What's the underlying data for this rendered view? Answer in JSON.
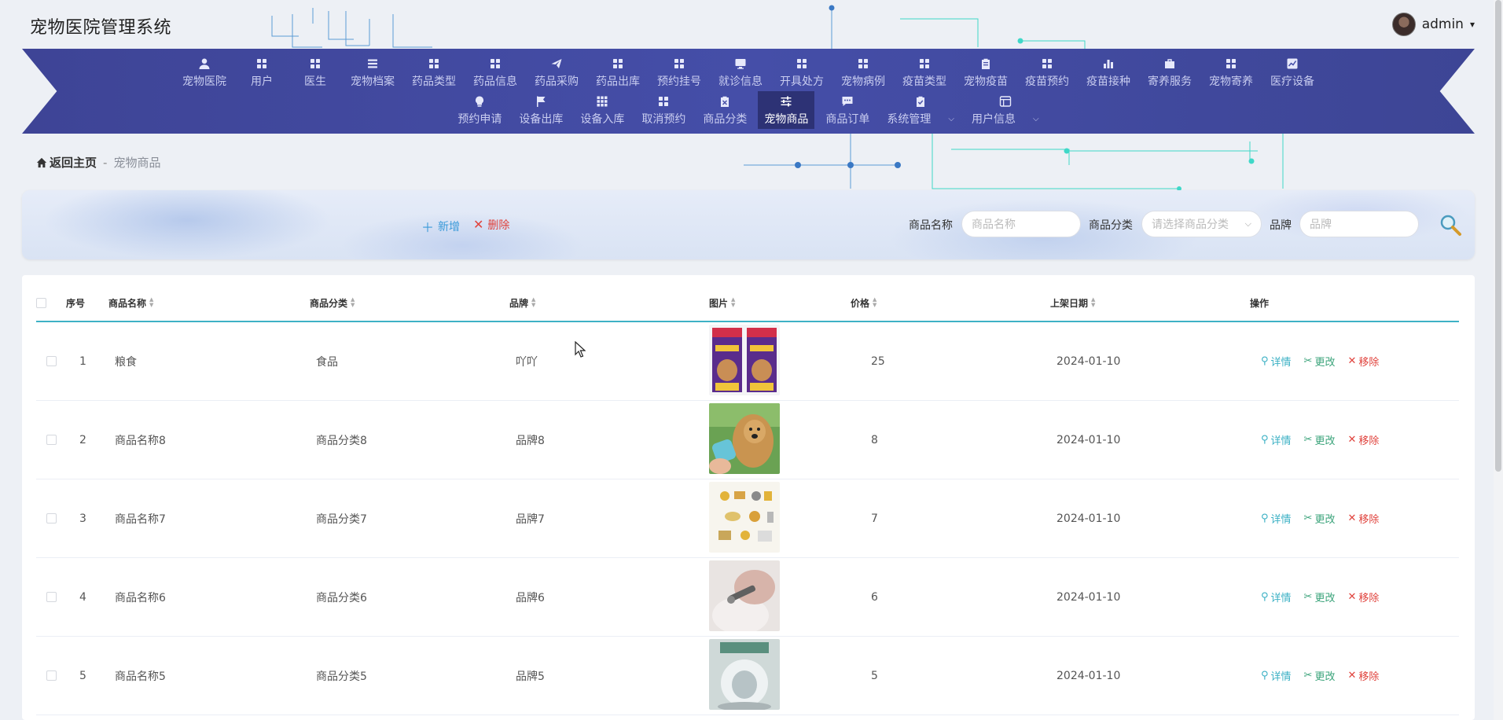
{
  "header": {
    "title": "宠物医院管理系统",
    "user": {
      "name": "admin",
      "caret": "▾"
    }
  },
  "nav": {
    "row1": [
      {
        "label": "宠物医院",
        "icon": "user-icon"
      },
      {
        "label": "用户",
        "icon": "grid-icon"
      },
      {
        "label": "医生",
        "icon": "grid-icon"
      },
      {
        "label": "宠物档案",
        "icon": "list-icon"
      },
      {
        "label": "药品类型",
        "icon": "grid-icon"
      },
      {
        "label": "药品信息",
        "icon": "grid-icon"
      },
      {
        "label": "药品采购",
        "icon": "send-icon"
      },
      {
        "label": "药品出库",
        "icon": "grid-icon"
      },
      {
        "label": "预约挂号",
        "icon": "grid-icon"
      },
      {
        "label": "就诊信息",
        "icon": "monitor-icon"
      },
      {
        "label": "开具处方",
        "icon": "grid-icon"
      },
      {
        "label": "宠物病例",
        "icon": "grid-icon"
      },
      {
        "label": "疫苗类型",
        "icon": "grid-icon"
      },
      {
        "label": "宠物疫苗",
        "icon": "clipboard-icon"
      },
      {
        "label": "疫苗预约",
        "icon": "grid-icon"
      },
      {
        "label": "疫苗接种",
        "icon": "bar-chart-icon"
      },
      {
        "label": "寄养服务",
        "icon": "briefcase-icon"
      },
      {
        "label": "宠物寄养",
        "icon": "grid-icon"
      },
      {
        "label": "医疗设备",
        "icon": "line-chart-icon"
      }
    ],
    "row2": [
      {
        "label": "预约申请",
        "icon": "bulb-icon"
      },
      {
        "label": "设备出库",
        "icon": "flag-icon"
      },
      {
        "label": "设备入库",
        "icon": "apps-icon"
      },
      {
        "label": "取消预约",
        "icon": "grid-icon"
      },
      {
        "label": "商品分类",
        "icon": "clipboard-x-icon"
      },
      {
        "label": "宠物商品",
        "icon": "sliders-icon",
        "active": true
      },
      {
        "label": "商品订单",
        "icon": "chat-icon"
      },
      {
        "label": "系统管理",
        "icon": "clipboard-check-icon",
        "dropdown": true
      },
      {
        "label": "用户信息",
        "icon": "window-icon",
        "dropdown": true
      }
    ]
  },
  "breadcrumb": {
    "home": "返回主页",
    "separator": "-",
    "current": "宠物商品"
  },
  "toolbar": {
    "add_label": "新增",
    "add_icon": "＋",
    "delete_label": "删除",
    "delete_icon": "✕"
  },
  "search": {
    "name_label": "商品名称",
    "name_placeholder": "商品名称",
    "category_label": "商品分类",
    "category_placeholder": "请选择商品分类",
    "brand_label": "品牌",
    "brand_placeholder": "品牌"
  },
  "table": {
    "headers": {
      "index": "序号",
      "name": "商品名称",
      "category": "商品分类",
      "brand": "品牌",
      "image": "图片",
      "price": "价格",
      "date": "上架日期",
      "ops": "操作"
    },
    "ops": {
      "detail": "详情",
      "edit": "更改",
      "remove": "移除"
    },
    "rows": [
      {
        "index": "1",
        "name": "粮食",
        "category": "食品",
        "brand": "吖吖",
        "price": "25",
        "date": "2024-01-10",
        "image": "cat-food-bags"
      },
      {
        "index": "2",
        "name": "商品名称8",
        "category": "商品分类8",
        "brand": "品牌8",
        "price": "8",
        "date": "2024-01-10",
        "image": "golden-retriever-bottle"
      },
      {
        "index": "3",
        "name": "商品名称7",
        "category": "商品分类7",
        "brand": "品牌7",
        "price": "7",
        "date": "2024-01-10",
        "image": "pet-supplies-illustration"
      },
      {
        "index": "4",
        "name": "商品名称6",
        "category": "商品分类6",
        "brand": "品牌6",
        "price": "6",
        "date": "2024-01-10",
        "image": "nail-clipper"
      },
      {
        "index": "5",
        "name": "商品名称5",
        "category": "商品分类5",
        "brand": "品牌5",
        "price": "5",
        "date": "2024-01-10",
        "image": "cat-litter-box"
      }
    ]
  },
  "colors": {
    "nav_bg": "#454ea8",
    "nav_active": "#2d3275",
    "accent": "#3db1c5",
    "danger": "#e0433d",
    "edit": "#3aa37a"
  }
}
